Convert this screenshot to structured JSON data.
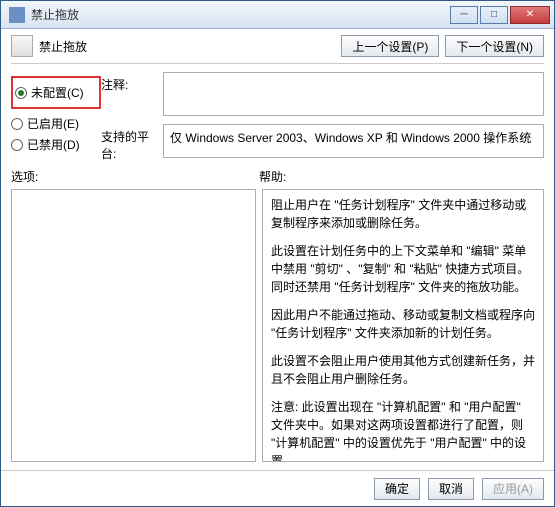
{
  "window": {
    "title": "禁止拖放"
  },
  "header": {
    "heading": "禁止拖放"
  },
  "nav": {
    "prev": "上一个设置(P)",
    "next": "下一个设置(N)"
  },
  "radios": {
    "not_configured": "未配置(C)",
    "enabled": "已启用(E)",
    "disabled": "已禁用(D)"
  },
  "labels": {
    "comment": "注释:",
    "platform": "支持的平台:",
    "options": "选项:",
    "help": "帮助:"
  },
  "platform_text": "仅 Windows Server 2003、Windows XP 和 Windows 2000 操作系统",
  "help_paragraphs": [
    "阻止用户在 \"任务计划程序\" 文件夹中通过移动或复制程序来添加或删除任务。",
    "此设置在计划任务中的上下文菜单和 \"编辑\" 菜单中禁用 \"剪切\" 、\"复制\" 和 \"粘贴\" 快捷方式项目。同时还禁用 \"任务计划程序\" 文件夹的拖放功能。",
    "因此用户不能通过拖动、移动或复制文档或程序向 \"任务计划程序\" 文件夹添加新的计划任务。",
    "此设置不会阻止用户使用其他方式创建新任务，并且不会阻止用户删除任务。",
    "注意: 此设置出现在 \"计算机配置\" 和 \"用户配置\" 文件夹中。如果对这两项设置都进行了配置，则 \"计算机配置\" 中的设置优先于 \"用户配置\" 中的设置。"
  ],
  "buttons": {
    "ok": "确定",
    "cancel": "取消",
    "apply": "应用(A)"
  }
}
